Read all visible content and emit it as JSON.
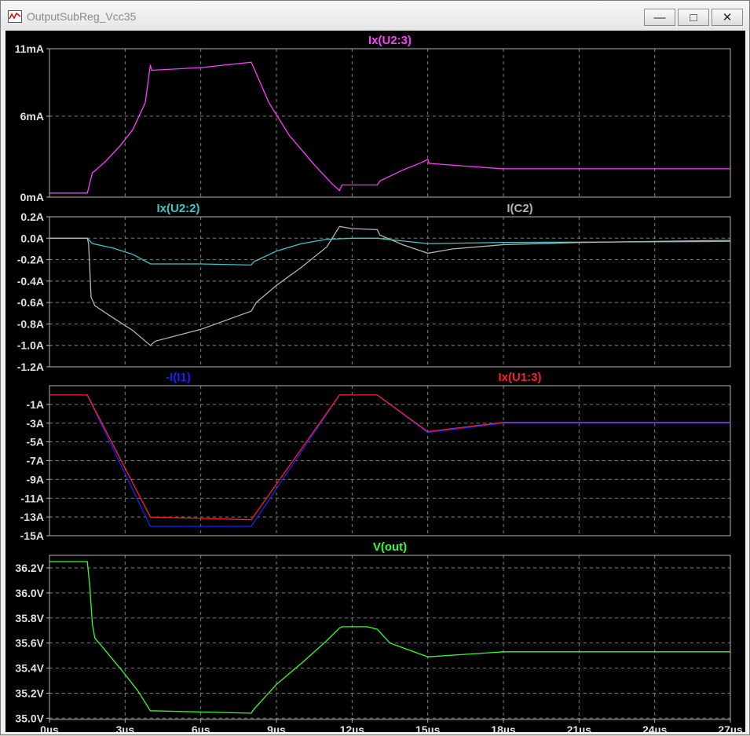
{
  "window": {
    "title": "OutputSubReg_Vcc35",
    "minimize_glyph": "—",
    "maximize_glyph": "□",
    "close_glyph": "✕"
  },
  "colors": {
    "background": "#000000",
    "frame": "#b4b4b4",
    "grid": "#7f7f7f",
    "axis_text": "#e0e0e0",
    "magenta": "#ff3cff",
    "cyan": "#3cc8c8",
    "gray": "#b4b4b4",
    "blue": "#1c1cff",
    "red": "#ff2020",
    "green": "#32ff32"
  },
  "chart_data": [
    {
      "type": "line",
      "x_ticks": [
        "0µs",
        "3µs",
        "6µs",
        "9µs",
        "12µs",
        "15µs",
        "18µs",
        "21µs",
        "24µs",
        "27µs"
      ],
      "xlim": [
        0,
        27
      ],
      "ylim": [
        0,
        11
      ],
      "y_ticks": [
        {
          "v": 11,
          "label": "11mA"
        },
        {
          "v": 6,
          "label": "6mA"
        },
        {
          "v": 0,
          "label": "0mA"
        }
      ],
      "grid": true,
      "series": [
        {
          "name": "Ix(U2:3)",
          "color": "magenta",
          "points": [
            [
              0,
              0.3
            ],
            [
              1.5,
              0.3
            ],
            [
              1.7,
              1.8
            ],
            [
              2.2,
              2.6
            ],
            [
              2.8,
              3.8
            ],
            [
              3.3,
              5.0
            ],
            [
              3.8,
              7.0
            ],
            [
              4.0,
              9.8
            ],
            [
              4.05,
              9.4
            ],
            [
              6,
              9.6
            ],
            [
              8.0,
              10.0
            ],
            [
              8.1,
              9.6
            ],
            [
              8.7,
              7.0
            ],
            [
              9.5,
              4.6
            ],
            [
              10.5,
              2.4
            ],
            [
              11.2,
              1.0
            ],
            [
              11.5,
              0.5
            ],
            [
              11.6,
              0.9
            ],
            [
              13,
              0.9
            ],
            [
              13.1,
              1.2
            ],
            [
              14,
              2.0
            ],
            [
              14.8,
              2.6
            ],
            [
              15.0,
              2.8
            ],
            [
              15.05,
              2.5
            ],
            [
              16.5,
              2.3
            ],
            [
              18,
              2.1
            ],
            [
              27,
              2.1
            ]
          ]
        }
      ]
    },
    {
      "type": "line",
      "x_ticks": [
        "0µs",
        "3µs",
        "6µs",
        "9µs",
        "12µs",
        "15µs",
        "18µs",
        "21µs",
        "24µs",
        "27µs"
      ],
      "xlim": [
        0,
        27
      ],
      "ylim": [
        -1.2,
        0.2
      ],
      "y_ticks": [
        {
          "v": 0.2,
          "label": "0.2A"
        },
        {
          "v": 0.0,
          "label": "0.0A"
        },
        {
          "v": -0.2,
          "label": "-0.2A"
        },
        {
          "v": -0.4,
          "label": "-0.4A"
        },
        {
          "v": -0.6,
          "label": "-0.6A"
        },
        {
          "v": -0.8,
          "label": "-0.8A"
        },
        {
          "v": -1.0,
          "label": "-1.0A"
        },
        {
          "v": -1.2,
          "label": "-1.2A"
        }
      ],
      "grid": true,
      "series": [
        {
          "name": "Ix(U2:2)",
          "color": "cyan",
          "points": [
            [
              0,
              0
            ],
            [
              1.5,
              0
            ],
            [
              1.7,
              -0.05
            ],
            [
              2.5,
              -0.09
            ],
            [
              3.3,
              -0.15
            ],
            [
              4.0,
              -0.24
            ],
            [
              6,
              -0.24
            ],
            [
              8,
              -0.25
            ],
            [
              8.1,
              -0.22
            ],
            [
              9,
              -0.12
            ],
            [
              10,
              -0.05
            ],
            [
              11,
              -0.01
            ],
            [
              12,
              0.0
            ],
            [
              13,
              0.0
            ],
            [
              15,
              -0.05
            ],
            [
              18,
              -0.04
            ],
            [
              27,
              -0.03
            ]
          ]
        },
        {
          "name": "I(C2)",
          "color": "gray",
          "points": [
            [
              0,
              0
            ],
            [
              1.5,
              0
            ],
            [
              1.55,
              -0.05
            ],
            [
              1.65,
              -0.55
            ],
            [
              1.8,
              -0.63
            ],
            [
              2.5,
              -0.74
            ],
            [
              3.3,
              -0.86
            ],
            [
              4.0,
              -1.0
            ],
            [
              4.2,
              -0.96
            ],
            [
              6,
              -0.85
            ],
            [
              8.0,
              -0.68
            ],
            [
              8.2,
              -0.6
            ],
            [
              9,
              -0.44
            ],
            [
              10,
              -0.27
            ],
            [
              11,
              -0.08
            ],
            [
              11.5,
              0.11
            ],
            [
              12,
              0.09
            ],
            [
              13,
              0.08
            ],
            [
              13.1,
              0.03
            ],
            [
              14,
              -0.06
            ],
            [
              15,
              -0.14
            ],
            [
              16,
              -0.1
            ],
            [
              18,
              -0.06
            ],
            [
              21,
              -0.04
            ],
            [
              27,
              -0.02
            ]
          ]
        }
      ]
    },
    {
      "type": "line",
      "x_ticks": [
        "0µs",
        "3µs",
        "6µs",
        "9µs",
        "12µs",
        "15µs",
        "18µs",
        "21µs",
        "24µs",
        "27µs"
      ],
      "xlim": [
        0,
        27
      ],
      "ylim": [
        -15,
        1
      ],
      "y_ticks": [
        {
          "v": -1,
          "label": "-1A"
        },
        {
          "v": -3,
          "label": "-3A"
        },
        {
          "v": -5,
          "label": "-5A"
        },
        {
          "v": -7,
          "label": "-7A"
        },
        {
          "v": -9,
          "label": "-9A"
        },
        {
          "v": -11,
          "label": "-11A"
        },
        {
          "v": -13,
          "label": "-13A"
        },
        {
          "v": -15,
          "label": "-15A"
        }
      ],
      "grid": true,
      "series": [
        {
          "name": "-I(I1)",
          "color": "blue",
          "points": [
            [
              0,
              0
            ],
            [
              1.5,
              0
            ],
            [
              4.0,
              -14.0
            ],
            [
              8.0,
              -14.0
            ],
            [
              11.5,
              0
            ],
            [
              13,
              0
            ],
            [
              15,
              -4.0
            ],
            [
              18,
              -3.0
            ],
            [
              21,
              -3.0
            ],
            [
              27,
              -3.0
            ]
          ]
        },
        {
          "name": "Ix(U1:3)",
          "color": "red",
          "points": [
            [
              0,
              0
            ],
            [
              1.5,
              0
            ],
            [
              4.0,
              -13.0
            ],
            [
              8.0,
              -13.3
            ],
            [
              11.5,
              0
            ],
            [
              13,
              0
            ],
            [
              15,
              -3.9
            ],
            [
              18,
              -2.9
            ],
            [
              21,
              -2.9
            ],
            [
              27,
              -2.9
            ]
          ]
        }
      ]
    },
    {
      "type": "line",
      "x_ticks": [
        "0µs",
        "3µs",
        "6µs",
        "9µs",
        "12µs",
        "15µs",
        "18µs",
        "21µs",
        "24µs",
        "27µs"
      ],
      "xlim": [
        0,
        27
      ],
      "ylim": [
        34.99,
        36.3
      ],
      "y_ticks": [
        {
          "v": 36.2,
          "label": "36.2V"
        },
        {
          "v": 36.0,
          "label": "36.0V"
        },
        {
          "v": 35.8,
          "label": "35.8V"
        },
        {
          "v": 35.6,
          "label": "35.6V"
        },
        {
          "v": 35.4,
          "label": "35.4V"
        },
        {
          "v": 35.2,
          "label": "35.2V"
        },
        {
          "v": 35.0,
          "label": "35.0V"
        }
      ],
      "grid": true,
      "series": [
        {
          "name": "V(out)",
          "color": "green",
          "points": [
            [
              0,
              36.25
            ],
            [
              1.5,
              36.25
            ],
            [
              1.6,
              36.05
            ],
            [
              1.7,
              35.75
            ],
            [
              1.8,
              35.64
            ],
            [
              2.3,
              35.52
            ],
            [
              3.0,
              35.35
            ],
            [
              3.5,
              35.22
            ],
            [
              4.0,
              35.06
            ],
            [
              6,
              35.05
            ],
            [
              8.0,
              35.04
            ],
            [
              8.1,
              35.07
            ],
            [
              9,
              35.27
            ],
            [
              10,
              35.44
            ],
            [
              11,
              35.62
            ],
            [
              11.5,
              35.72
            ],
            [
              11.6,
              35.73
            ],
            [
              12.6,
              35.73
            ],
            [
              13,
              35.71
            ],
            [
              13.5,
              35.6
            ],
            [
              15,
              35.49
            ],
            [
              16.5,
              35.51
            ],
            [
              18,
              35.53
            ],
            [
              27,
              35.53
            ]
          ]
        }
      ]
    }
  ]
}
